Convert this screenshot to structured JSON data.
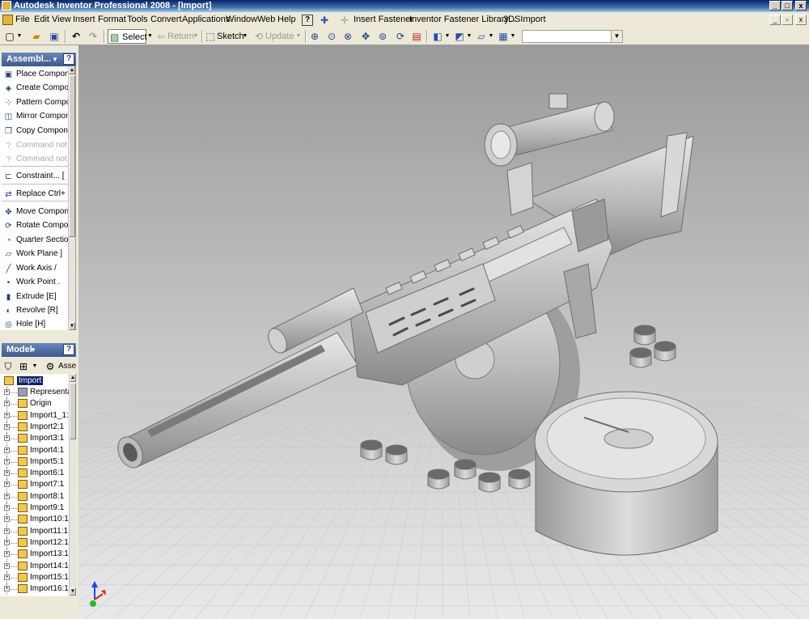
{
  "window": {
    "title": "Autodesk Inventor Professional 2008 - [Import]",
    "min_glyph": "_",
    "max_glyph": "□",
    "close_glyph": "x"
  },
  "menu": {
    "items": [
      "File",
      "Edit",
      "View",
      "Insert",
      "Format",
      "Tools",
      "Convert",
      "Applications",
      "Window",
      "Web",
      "Help"
    ],
    "extras": [
      "Insert Fastener",
      "Inventor Fastener Library...",
      "3DSImport"
    ]
  },
  "toolbar": {
    "select_label": "Select",
    "return_label": "Return",
    "sketch_label": "Sketch",
    "update_label": "Update",
    "search_value": ""
  },
  "panelbar": {
    "title": "Assembl...",
    "help": "?",
    "commands": [
      {
        "label": "Place Componen",
        "icon": "place-component-icon",
        "enabled": true
      },
      {
        "label": "Create Compon",
        "icon": "create-component-icon",
        "enabled": true
      },
      {
        "label": "Pattern Compor",
        "icon": "pattern-component-icon",
        "enabled": true
      },
      {
        "label": "Mirror Compone",
        "icon": "mirror-component-icon",
        "enabled": true
      },
      {
        "label": "Copy Componen",
        "icon": "copy-component-icon",
        "enabled": true
      },
      {
        "label": "Command not lo",
        "icon": "command-not-loaded-icon",
        "enabled": false
      },
      {
        "label": "Command not lo",
        "icon": "command-not-loaded-icon",
        "enabled": false
      },
      {
        "label": "Constraint...    [",
        "icon": "constraint-icon",
        "enabled": true
      },
      {
        "label": "Replace    Ctrl+",
        "icon": "replace-icon",
        "enabled": true
      },
      {
        "label": "Move Componen",
        "icon": "move-component-icon",
        "enabled": true
      },
      {
        "label": "Rotate Compon",
        "icon": "rotate-component-icon",
        "enabled": true
      },
      {
        "label": "Quarter Section",
        "icon": "quarter-section-icon",
        "enabled": true
      },
      {
        "label": "Work Plane    ]",
        "icon": "work-plane-icon",
        "enabled": true
      },
      {
        "label": "Work Axis    /",
        "icon": "work-axis-icon",
        "enabled": true
      },
      {
        "label": "Work Point    .",
        "icon": "work-point-icon",
        "enabled": true
      },
      {
        "label": "Extrude    [E]",
        "icon": "extrude-icon",
        "enabled": true
      },
      {
        "label": "Revolve    [R]",
        "icon": "revolve-icon",
        "enabled": true
      },
      {
        "label": "Hole    [H]",
        "icon": "hole-icon",
        "enabled": true
      }
    ]
  },
  "browser": {
    "title": "Model",
    "help": "?",
    "assembly_label": "Asse",
    "root": "Import",
    "nodes": [
      "Representa",
      "Origin",
      "Import1_1:",
      "Import2:1",
      "Import3:1",
      "Import4:1",
      "Import5:1",
      "Import6:1",
      "Import7:1",
      "Import8:1",
      "Import9:1",
      "Import10:1",
      "Import11:1",
      "Import12:1",
      "Import13:1",
      "Import14:1",
      "Import15:1",
      "Import16:1"
    ]
  },
  "colors": {
    "titlebar": "#0a246a",
    "model": "#c7c7c7",
    "grid": "#b9c6c2",
    "axis_x": "#e02020",
    "axis_y": "#20c020",
    "axis_z": "#2040ff"
  }
}
